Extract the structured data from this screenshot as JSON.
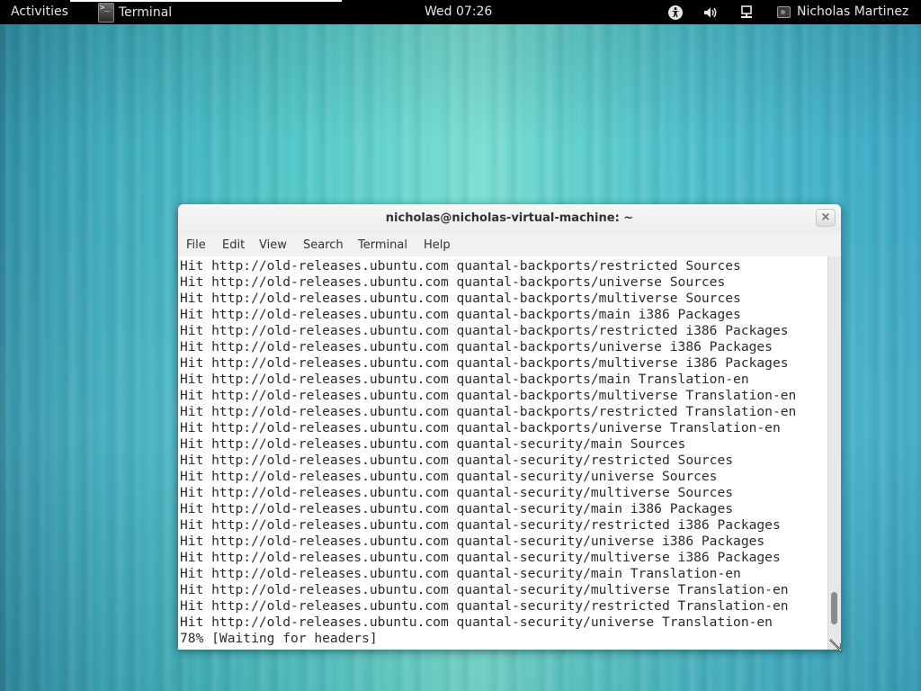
{
  "topbar": {
    "activities": "Activities",
    "app_name": "Terminal",
    "app_icon_glyph": ">_",
    "clock": "Wed 07:26",
    "user_name": "Nicholas Martinez",
    "tray_icons": [
      "accessibility-icon",
      "volume-icon",
      "network-wired-icon"
    ]
  },
  "window": {
    "title": "nicholas@nicholas-virtual-machine: ~",
    "close_glyph": "×",
    "menu": [
      "File",
      "Edit",
      "View",
      "Search",
      "Terminal",
      "Help"
    ],
    "scroll_position": 0.94
  },
  "terminal": {
    "lines": [
      "Hit http://old-releases.ubuntu.com quantal-backports/restricted Sources",
      "Hit http://old-releases.ubuntu.com quantal-backports/universe Sources",
      "Hit http://old-releases.ubuntu.com quantal-backports/multiverse Sources",
      "Hit http://old-releases.ubuntu.com quantal-backports/main i386 Packages",
      "Hit http://old-releases.ubuntu.com quantal-backports/restricted i386 Packages",
      "Hit http://old-releases.ubuntu.com quantal-backports/universe i386 Packages",
      "Hit http://old-releases.ubuntu.com quantal-backports/multiverse i386 Packages",
      "Hit http://old-releases.ubuntu.com quantal-backports/main Translation-en",
      "Hit http://old-releases.ubuntu.com quantal-backports/multiverse Translation-en",
      "Hit http://old-releases.ubuntu.com quantal-backports/restricted Translation-en",
      "Hit http://old-releases.ubuntu.com quantal-backports/universe Translation-en",
      "Hit http://old-releases.ubuntu.com quantal-security/main Sources",
      "Hit http://old-releases.ubuntu.com quantal-security/restricted Sources",
      "Hit http://old-releases.ubuntu.com quantal-security/universe Sources",
      "Hit http://old-releases.ubuntu.com quantal-security/multiverse Sources",
      "Hit http://old-releases.ubuntu.com quantal-security/main i386 Packages",
      "Hit http://old-releases.ubuntu.com quantal-security/restricted i386 Packages",
      "Hit http://old-releases.ubuntu.com quantal-security/universe i386 Packages",
      "Hit http://old-releases.ubuntu.com quantal-security/multiverse i386 Packages",
      "Hit http://old-releases.ubuntu.com quantal-security/main Translation-en",
      "Hit http://old-releases.ubuntu.com quantal-security/multiverse Translation-en",
      "Hit http://old-releases.ubuntu.com quantal-security/restricted Translation-en",
      "Hit http://old-releases.ubuntu.com quantal-security/universe Translation-en",
      "78% [Waiting for headers]"
    ]
  },
  "colors": {
    "topbar_bg": "#000000",
    "terminal_bg": "#ffffff",
    "terminal_fg": "#2b2b2b",
    "window_chrome": "#f2f1f0"
  }
}
